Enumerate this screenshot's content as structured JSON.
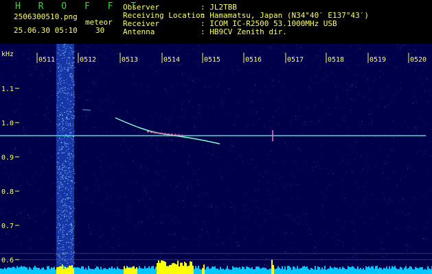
{
  "header": {
    "app_name": "H R O F F T",
    "filename": "2506300510.png",
    "datetime": "25.06.30 05:10",
    "count_label": "meteor",
    "count_value": "30",
    "fields": [
      {
        "label": "Observer",
        "value": ": JL2TBB"
      },
      {
        "label": "Receiving Location",
        "value": ": Hamamatsu, Japan (N34°40′ E137°43′)"
      },
      {
        "label": "Receiver",
        "value": ": ICOM IC-R2500 53.1000MHz USB"
      },
      {
        "label": "Antenna",
        "value": ": HB9CV Zenith dir."
      }
    ]
  },
  "spectrogram": {
    "y_unit": "kHz",
    "y_ticks": [
      "1.1",
      "1.0",
      "0.9",
      "0.8",
      "0.7",
      "0.6"
    ],
    "x_ticks": [
      "0511",
      "0512",
      "0513",
      "0514",
      "0515",
      "0516",
      "0517",
      "0518",
      "0519",
      "0520"
    ],
    "colors": {
      "background": "#00004a",
      "noise": "#1e3cb4",
      "carrier_line": "#4fd8d8",
      "meteor_trail": "#7fffd4",
      "meteor_head": "#ff5aa0",
      "level_bars": "#00c8ff",
      "level_peaks": "#ffff00",
      "tick_text": "#ffff66",
      "grid_line": "#c0c0c0"
    }
  }
}
